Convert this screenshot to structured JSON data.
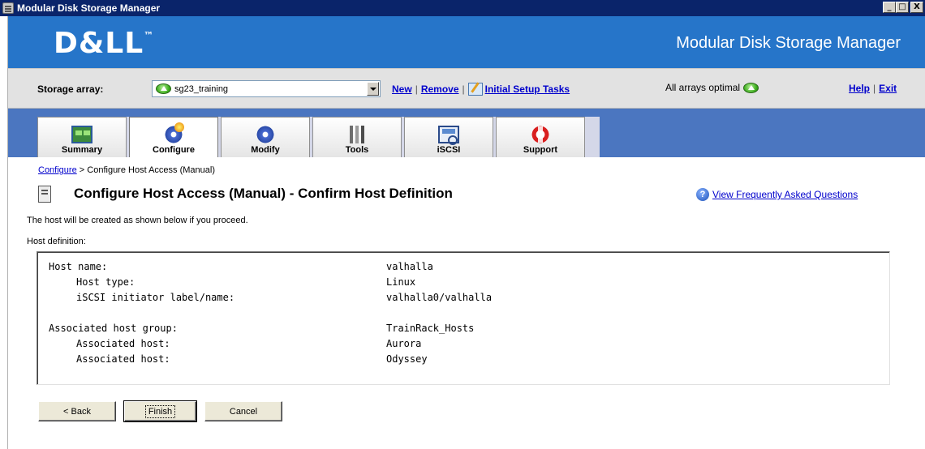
{
  "window": {
    "title": "Modular Disk Storage Manager",
    "controls": {
      "minimize": "_",
      "maximize": "□",
      "close": "X"
    }
  },
  "banner": {
    "logo": "D&LL",
    "trademark": "™",
    "product": "Modular Disk Storage Manager",
    "bg": "#2675c9"
  },
  "array_bar": {
    "label": "Storage array:",
    "selected_array": "sg23_training",
    "links": {
      "new": "New",
      "remove": "Remove",
      "setup": "Initial Setup Tasks"
    },
    "status_text": "All arrays optimal",
    "help": "Help",
    "exit": "Exit"
  },
  "tabs": [
    {
      "label": "Summary",
      "icon": "summary-icon"
    },
    {
      "label": "Configure",
      "icon": "configure-gear-icon",
      "active": true
    },
    {
      "label": "Modify",
      "icon": "modify-gear-icon"
    },
    {
      "label": "Tools",
      "icon": "tools-icon"
    },
    {
      "label": "iSCSI",
      "icon": "iscsi-icon"
    },
    {
      "label": "Support",
      "icon": "support-lifebuoy-icon"
    }
  ],
  "breadcrumb": {
    "link": "Configure",
    "separator": ">",
    "current": "Configure Host Access (Manual)"
  },
  "page": {
    "title": "Configure Host Access (Manual) - Confirm Host Definition",
    "faq": "View Frequently Asked Questions",
    "intro": "The host will be created as shown below if you proceed.",
    "host_def_label": "Host definition:"
  },
  "host_definition": [
    {
      "key": "Host name:",
      "value": "valhalla"
    },
    {
      "key": "Host type:",
      "value": "Linux"
    },
    {
      "key": "iSCSI initiator label/name:",
      "value": "valhalla0/valhalla"
    },
    {
      "key": "Associated host group:",
      "value": "TrainRack_Hosts"
    },
    {
      "key": "Associated host:",
      "value": "Aurora"
    },
    {
      "key": "Associated host:",
      "value": "Odyssey"
    }
  ],
  "buttons": {
    "back": "< Back",
    "finish": "Finish",
    "cancel": "Cancel"
  }
}
